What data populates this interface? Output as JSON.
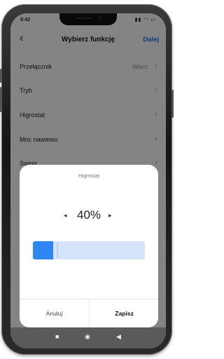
{
  "status": {
    "time": "9:42",
    "icons": "▮▮ ◠ ▭"
  },
  "header": {
    "back_icon": "‹",
    "title": "Wybierz funkcję",
    "next_label": "Dalej"
  },
  "settings": [
    {
      "label": "Przełącznik",
      "value": "Włącz"
    },
    {
      "label": "Tryb",
      "value": ""
    },
    {
      "label": "Higrostat",
      "value": ""
    },
    {
      "label": "Moc nawiewu",
      "value": ""
    },
    {
      "label": "Swing",
      "value": ""
    }
  ],
  "chevron": "›",
  "dialog": {
    "title": "Higrostat",
    "value": "40%",
    "decrease_icon": "◂",
    "increase_icon": "▸",
    "slider_fraction": 0.4,
    "cancel_label": "Anuluj",
    "save_label": "Zapisz"
  },
  "sysnav": {
    "square": "■",
    "circle": "◉",
    "back": "◀"
  },
  "colors": {
    "accent": "#1e72e8",
    "slider_fill": "#2f86f2",
    "slider_track": "#d6e4fb"
  }
}
